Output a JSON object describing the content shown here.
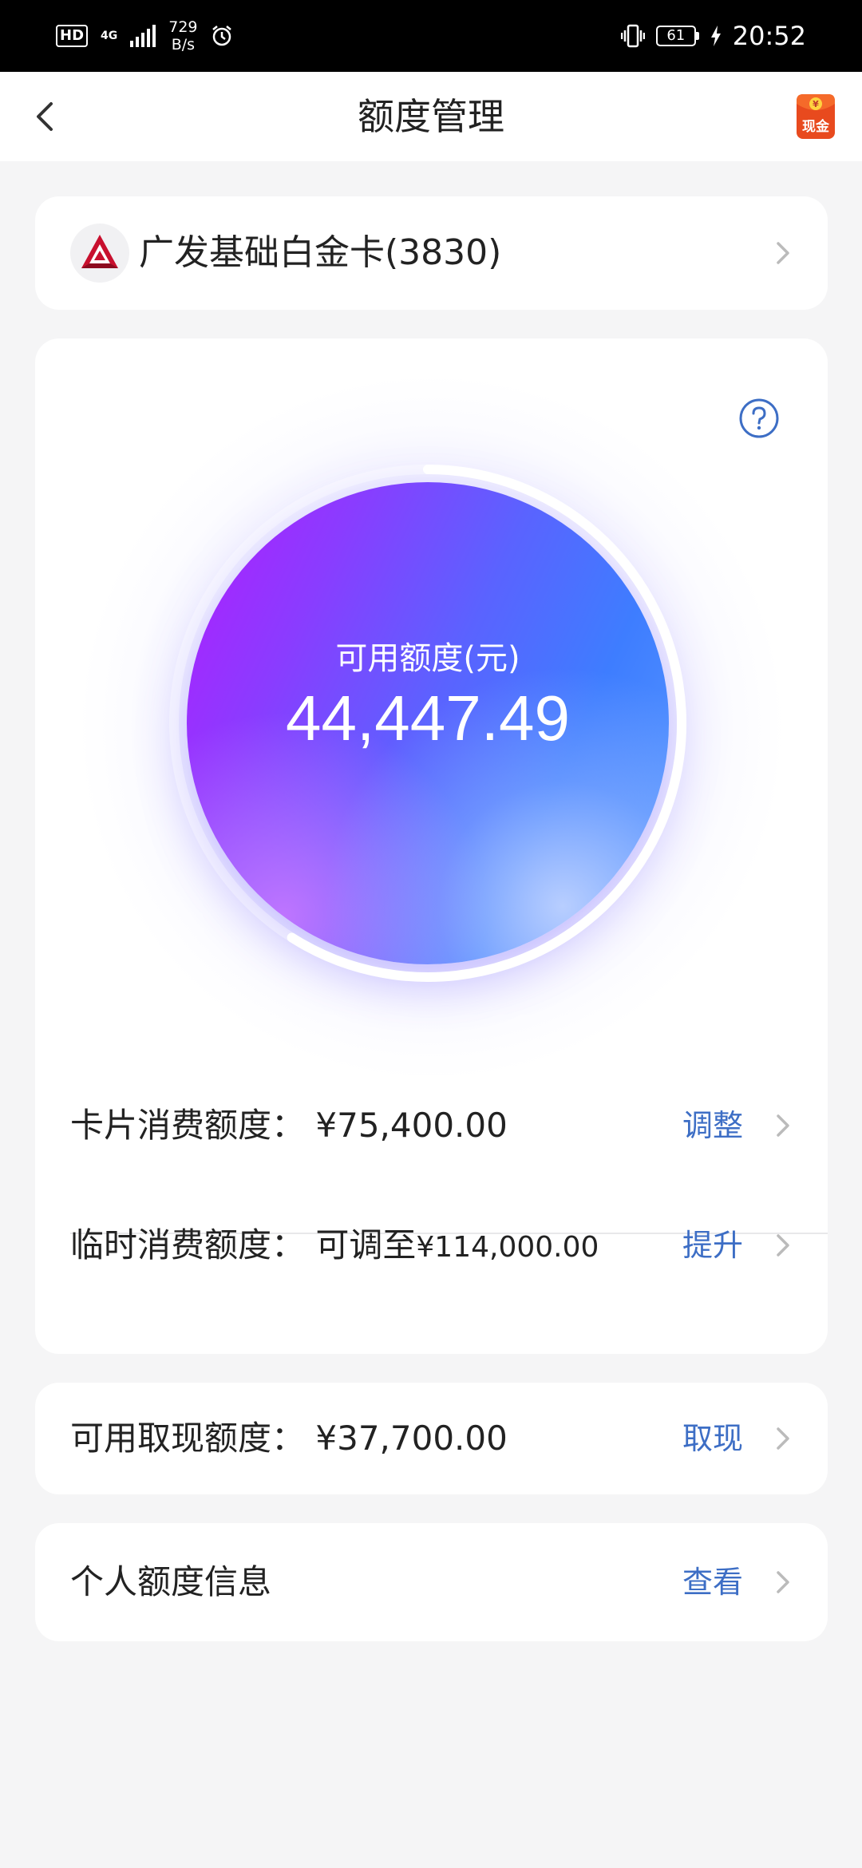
{
  "status_bar": {
    "hd": "HD",
    "network": "4G",
    "speed_value": "729",
    "speed_unit": "B/s",
    "battery": "61",
    "time": "20:52",
    "icons": [
      "alarm-icon",
      "vibrate-icon",
      "battery-icon",
      "charging-icon"
    ]
  },
  "header": {
    "title": "额度管理",
    "cash_badge_top": "¥",
    "cash_badge": "现金"
  },
  "bank_card": {
    "name": "广发基础白金卡(3830)"
  },
  "available": {
    "label": "可用额度(元)",
    "value": "44,447.49",
    "ring_fraction": 0.59
  },
  "limits": [
    {
      "label": "卡片消费额度：",
      "amount": "¥75,400.00",
      "action": "调整"
    },
    {
      "label": "临时消费额度：",
      "prefix": "可调至",
      "amount": "¥114,000.00",
      "action": "提升"
    }
  ],
  "cash": {
    "label": "可用取现额度：",
    "amount": "¥37,700.00",
    "action": "取现"
  },
  "personal": {
    "label": "个人额度信息",
    "action": "查看"
  },
  "colors": {
    "accent_link": "#3d6ec5",
    "orb_purple": "#b21cff",
    "orb_blue": "#3e7dff",
    "bank_red": "#c8102e"
  }
}
